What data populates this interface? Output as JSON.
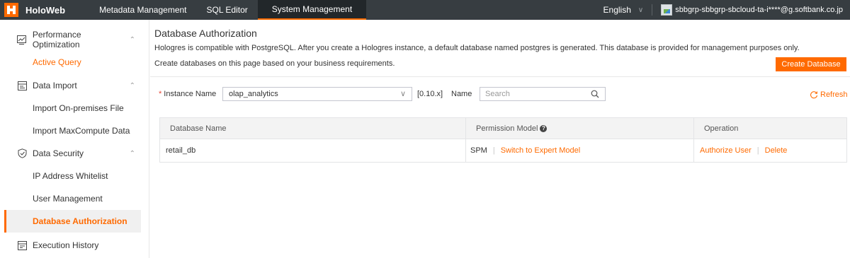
{
  "topbar": {
    "brand": "HoloWeb",
    "nav": [
      "Metadata Management",
      "SQL Editor",
      "System Management"
    ],
    "active_nav": "System Management",
    "language": "English",
    "account": "sbbgrp-sbbgrp-sbcloud-ta-i****@g.softbank.co.jp"
  },
  "sidebar": {
    "groups": [
      {
        "label": "Performance Optimization",
        "icon": "chart-icon",
        "items": [
          "Active Query"
        ]
      },
      {
        "label": "Data Import",
        "icon": "import-icon",
        "items": [
          "Import On-premises File",
          "Import MaxCompute Data"
        ]
      },
      {
        "label": "Data Security",
        "icon": "shield-icon",
        "items": [
          "IP Address Whitelist",
          "User Management",
          "Database Authorization"
        ]
      },
      {
        "label": "Execution History",
        "icon": "history-icon",
        "items": []
      }
    ],
    "selected_item": "Database Authorization"
  },
  "main": {
    "title": "Database Authorization",
    "description_line1": "Hologres is compatible with PostgreSQL. After you create a Hologres instance, a default database named postgres is generated. This database is provided for management purposes only.",
    "description_line2": "Create databases on this page based on your business requirements.",
    "create_button": "Create Database",
    "filter": {
      "instance_label": "Instance Name",
      "instance_value": "olap_analytics",
      "version": "[0.10.x]",
      "name_label": "Name",
      "search_placeholder": "Search",
      "refresh": "Refresh"
    },
    "table": {
      "headers": [
        "Database Name",
        "Permission Model",
        "Operation"
      ],
      "rows": [
        {
          "database_name": "retail_db",
          "permission_model": "SPM",
          "switch_action": "Switch to Expert Model",
          "actions": [
            "Authorize User",
            "Delete"
          ]
        }
      ]
    }
  },
  "colors": {
    "accent": "#ff6a00",
    "topbar_bg": "#373d41"
  }
}
